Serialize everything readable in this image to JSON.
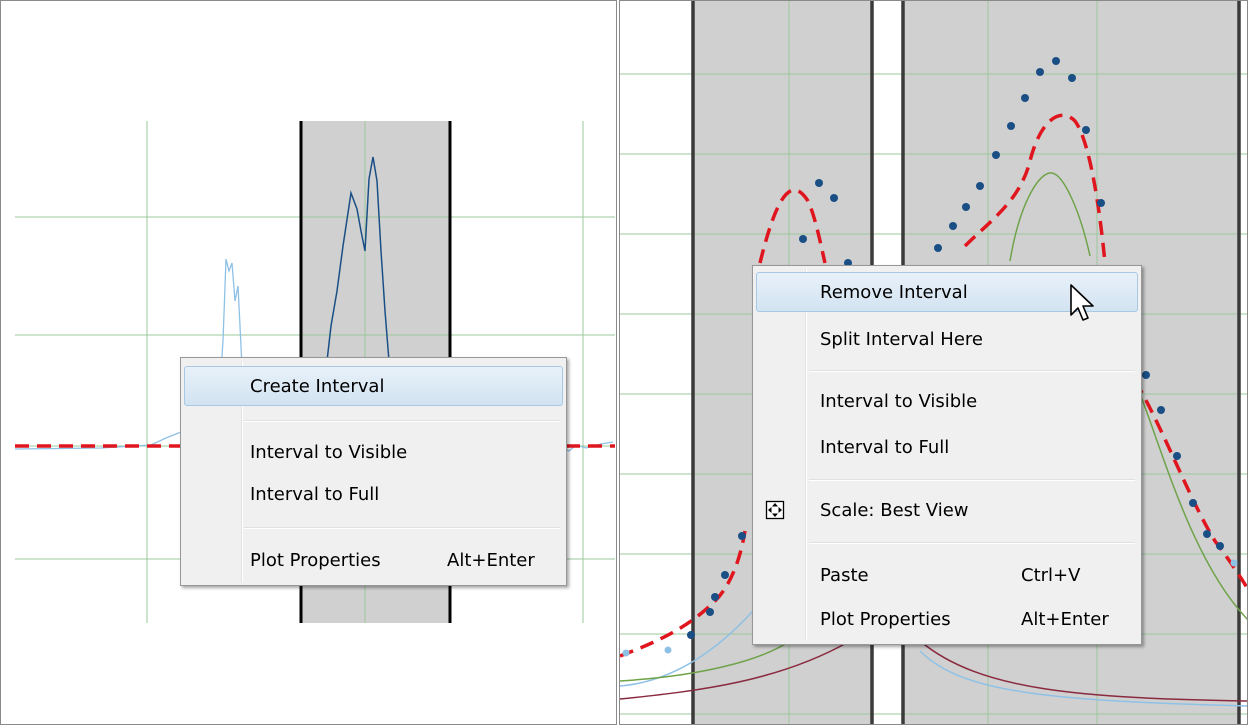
{
  "left_menu": {
    "items": [
      {
        "label": "Create Interval",
        "shortcut": "",
        "highlighted": true
      },
      {
        "label": "Interval to Visible",
        "shortcut": ""
      },
      {
        "label": "Interval to Full",
        "shortcut": ""
      },
      {
        "label": "Plot Properties",
        "shortcut": "Alt+Enter"
      }
    ]
  },
  "right_menu": {
    "items": [
      {
        "label": "Remove Interval",
        "shortcut": "",
        "highlighted": true
      },
      {
        "label": "Split Interval Here",
        "shortcut": ""
      },
      {
        "label": "Interval to Visible",
        "shortcut": ""
      },
      {
        "label": "Interval to Full",
        "shortcut": ""
      },
      {
        "label": "Scale: Best View",
        "shortcut": "",
        "icon": "best-view-icon"
      },
      {
        "label": "Paste",
        "shortcut": "Ctrl+V"
      },
      {
        "label": "Plot Properties",
        "shortcut": "Alt+Enter"
      }
    ]
  },
  "colors": {
    "grid": "#9bc89b",
    "interval_fill": "#d0d0d0",
    "interval_border": "#000000",
    "fit_dashed": "#e0161f",
    "data_points": "#1a4f86",
    "peak_component": "#6fa34a",
    "background_component": "#8a2a3e",
    "secondary_component": "#8ec1e6"
  }
}
